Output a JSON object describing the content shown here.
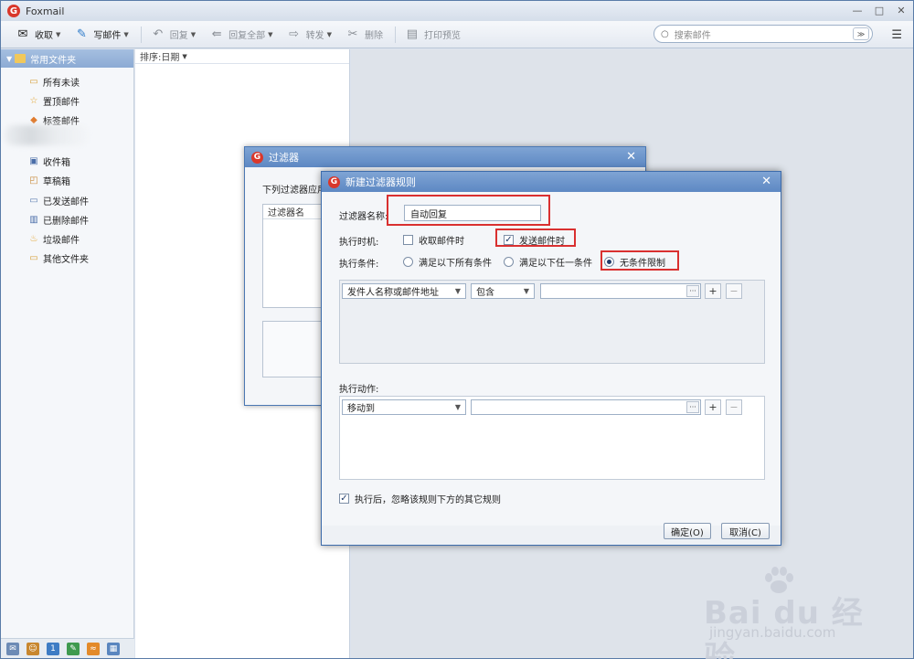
{
  "app": {
    "title": "Foxmail",
    "logo_letter": "G"
  },
  "window_controls": {
    "minimize": "—",
    "maximize": "□",
    "close": "✕"
  },
  "toolbar": {
    "receive": "收取",
    "compose": "写邮件",
    "reply": "回复",
    "reply_all": "回复全部",
    "forward": "转发",
    "delete": "删除",
    "print_preview": "打印预览"
  },
  "search": {
    "placeholder": "搜索邮件"
  },
  "sidebar": {
    "header": "常用文件夹",
    "items": [
      {
        "label": "所有未读",
        "icon": "folder-icon"
      },
      {
        "label": "置顶邮件",
        "icon": "star-icon"
      },
      {
        "label": "标签邮件",
        "icon": "tag-icon"
      },
      {
        "label": "收件箱",
        "icon": "inbox-icon"
      },
      {
        "label": "草稿箱",
        "icon": "draft-icon"
      },
      {
        "label": "已发送邮件",
        "icon": "sent-icon"
      },
      {
        "label": "已删除邮件",
        "icon": "trash-icon"
      },
      {
        "label": "垃圾邮件",
        "icon": "junk-icon"
      },
      {
        "label": "其他文件夹",
        "icon": "folder-icon"
      }
    ]
  },
  "list_pane": {
    "sort_label": "排序:日期"
  },
  "filter_dialog": {
    "title": "过滤器",
    "intro": "下列过滤器应用",
    "column_header": "过滤器名"
  },
  "rule_dialog": {
    "title": "新建过滤器规则",
    "name_label": "过滤器名称:",
    "name_value": "自动回复",
    "timing_label": "执行时机:",
    "timing_receive": "收取邮件时",
    "timing_send": "发送邮件时",
    "timing_receive_checked": false,
    "timing_send_checked": true,
    "condition_label": "执行条件:",
    "cond_all": "满足以下所有条件",
    "cond_any": "满足以下任一条件",
    "cond_none": "无条件限制",
    "condition_field": "发件人名称或邮件地址",
    "condition_op": "包含",
    "action_label": "执行动作:",
    "action_value": "移动到",
    "ignore_rules": "执行后，忽略该规则下方的其它规则",
    "ok": "确定(O)",
    "cancel": "取消(C)"
  },
  "watermark": {
    "brand": "Bai du 经验",
    "url": "jingyan.baidu.com"
  },
  "colors": {
    "accent": "#5d88c3",
    "highlight": "#d93030"
  }
}
